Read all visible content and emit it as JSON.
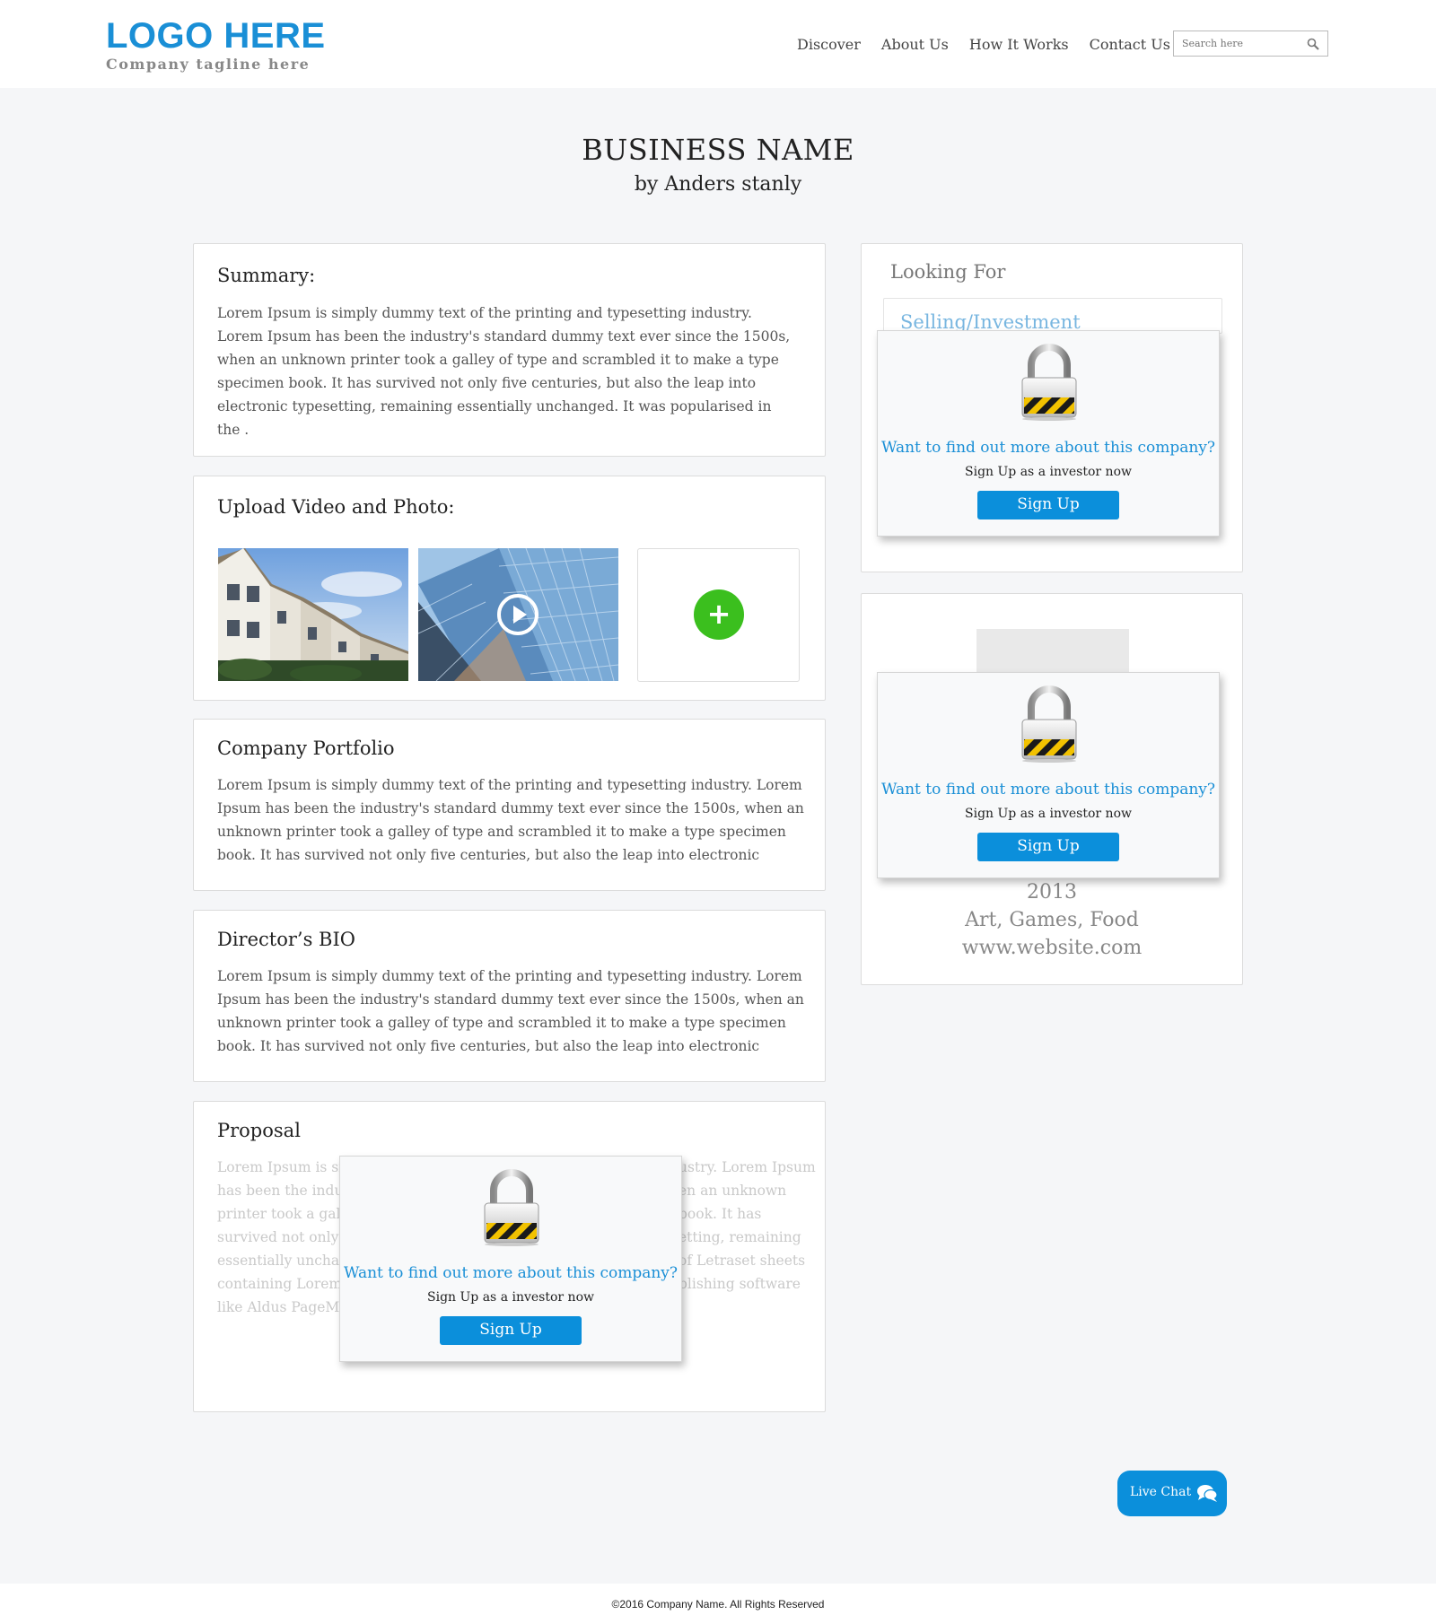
{
  "header": {
    "logo_text": "LOGO HERE",
    "tagline": "Company tagline here",
    "nav": [
      "Discover",
      "About Us",
      "How It Works",
      "Contact Us"
    ],
    "search_placeholder": "Search here"
  },
  "business": {
    "name": "BUSINESS NAME",
    "byline": "by Anders stanly"
  },
  "summary": {
    "title": "Summary:",
    "text": "Lorem Ipsum is simply dummy text of the printing and typesetting industry. Lorem Ipsum has been the industry's standard dummy text ever since the 1500s, when an unknown printer took a galley of type and scrambled it to make a type specimen book. It has survived not only five centuries, but also the leap into electronic typesetting, remaining essentially unchanged. It was popularised in the ."
  },
  "upload": {
    "title": "Upload Video and Photo:",
    "add_label": "+"
  },
  "portfolio": {
    "title": "Company Portfolio",
    "text": "Lorem Ipsum is simply dummy text of the printing and typesetting industry. Lorem Ipsum has been the industry's standard dummy text ever since the 1500s, when an unknown printer took a galley of type and scrambled it to make a type specimen book. It has survived not only five centuries, but also the leap into electronic typesetting, remaining"
  },
  "bio": {
    "title": "Director’s BIO",
    "text": "Lorem Ipsum is simply dummy text of the printing and typesetting industry. Lorem Ipsum has been the industry's standard dummy text ever since the 1500s, when an unknown printer took a galley of type and scrambled it to make a type specimen book. It has survived not only five centuries, but also the leap into electronic typesetting, remaining"
  },
  "proposal": {
    "title": "Proposal",
    "lines_left": [
      "Lorem Ipsum is sir",
      "has been the indus",
      "printer took a galle",
      "survived not only f",
      "essentially unchan",
      "containing Lorem I",
      "like Aldus PageMal"
    ],
    "lines_right": [
      "ustry. Lorem Ipsum",
      "en an unknown",
      "book. It has",
      "etting, remaining",
      "of Letraset sheets",
      "blishing software",
      ""
    ]
  },
  "lock_popup": {
    "question": "Want to find out more about this company?",
    "subtitle": "Sign Up as a investor now",
    "button": "Sign Up"
  },
  "looking_for": {
    "title": "Looking For",
    "value": "Selling/Investment"
  },
  "company_info": {
    "year": "2013",
    "categories": "Art, Games, Food",
    "website": "www.website.com"
  },
  "live_chat": "Live Chat",
  "footer": "©2016 Company Name. All Rights Reserved",
  "colors": {
    "accent": "#1a8fd6",
    "button": "#0b8fdb",
    "add": "#3bbf1e"
  }
}
